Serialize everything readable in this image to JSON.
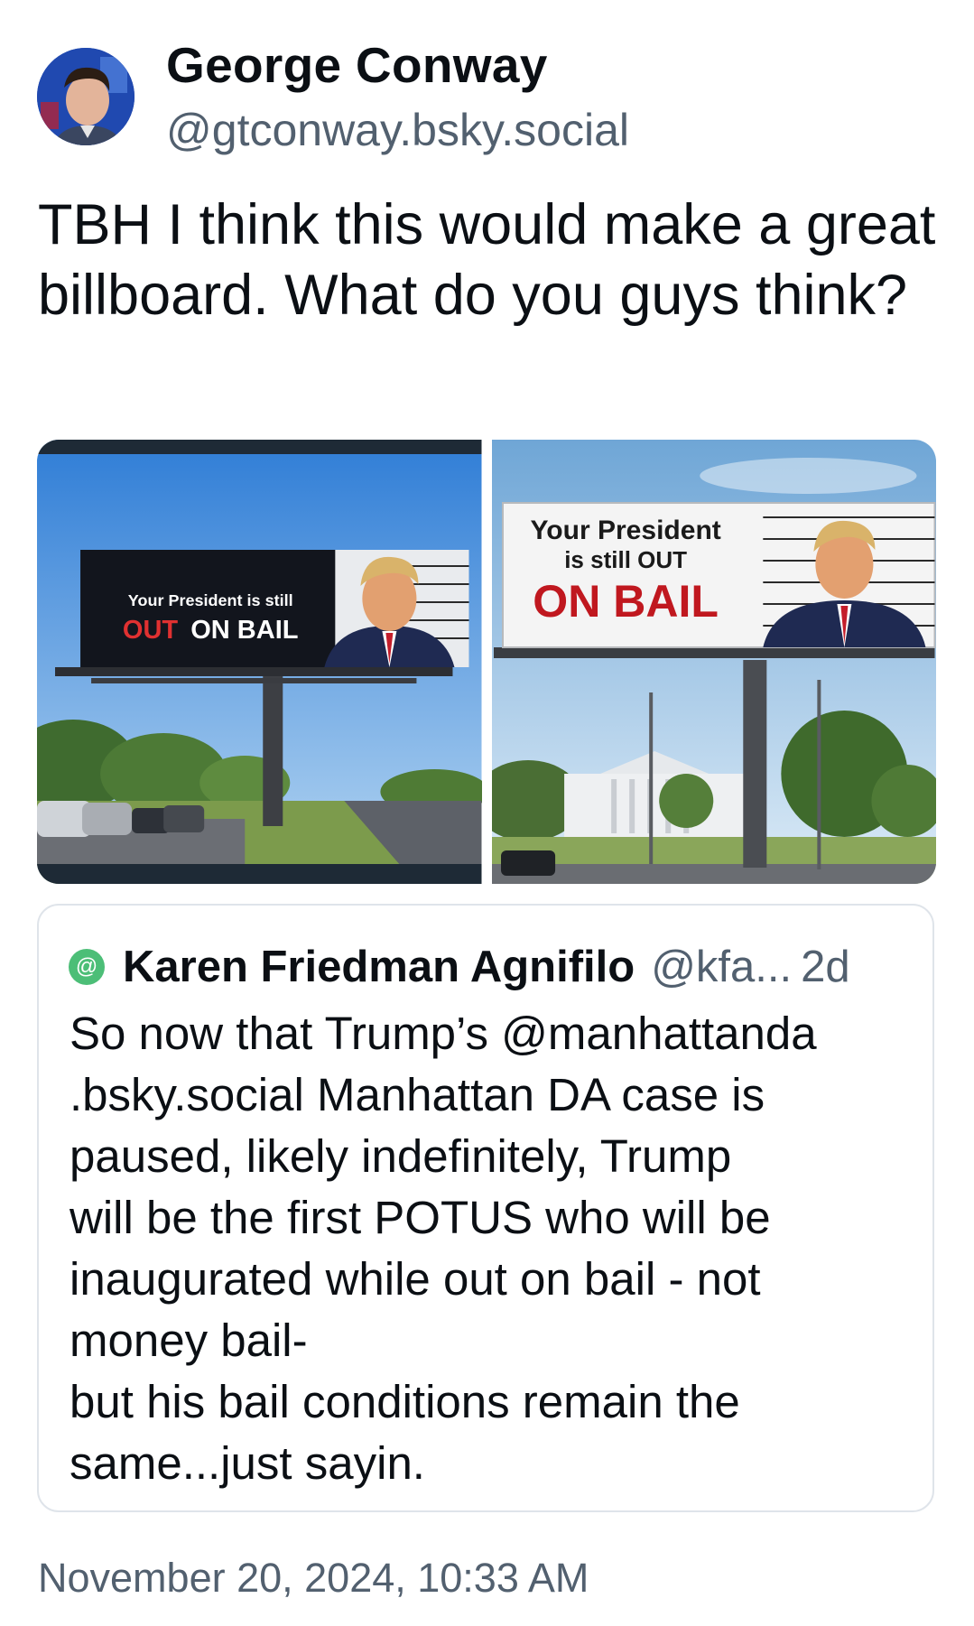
{
  "author": {
    "display_name": "George Conway",
    "handle": "@gtconway.bsky.social",
    "avatar_icon": "user-avatar-photo"
  },
  "post": {
    "text": "TBH I think this would make a great billboard. What do you guys think?",
    "timestamp": "November 20, 2024, 10:33 AM"
  },
  "images": [
    {
      "billboard_line1": "Your President is still",
      "billboard_line2_a": "OUT",
      "billboard_line2_b": "ON BAIL"
    },
    {
      "billboard_line1": "Your President",
      "billboard_line2": "is still OUT",
      "billboard_line3": "ON BAIL"
    }
  ],
  "quote": {
    "avatar_icon": "at-sign-avatar",
    "avatar_glyph": "@",
    "author_name": "Karen Friedman Agnifilo",
    "author_handle": "@kfa...",
    "time_ago": "2d",
    "text": "So now that Trump’s @manhattanda\n.bsky.social Manhattan DA case is\npaused, likely indefinitely, Trump\nwill be the first POTUS who will be\ninaugurated while out on bail - not\nmoney bail-\nbut his bail conditions remain the\nsame...just sayin."
  },
  "colors": {
    "text_primary": "#0b0f14",
    "text_secondary": "#52606f",
    "border": "#dfe4ea",
    "quote_avatar": "#4cbe77"
  }
}
